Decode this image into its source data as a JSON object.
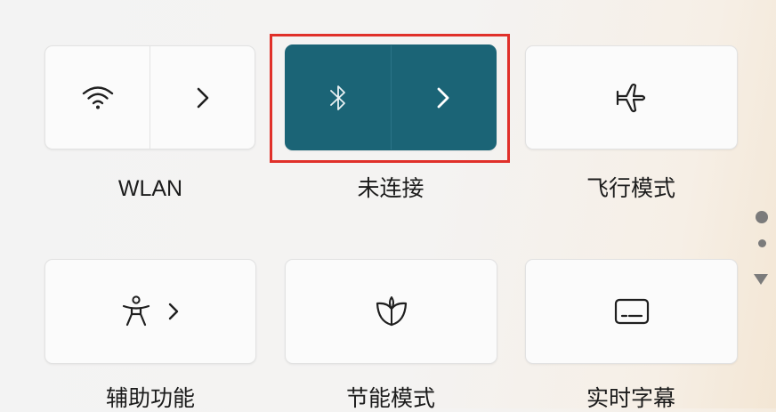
{
  "tiles": {
    "wlan": {
      "label": "WLAN",
      "icon": "wifi-icon",
      "chevron": "chevron-right-icon"
    },
    "bluetooth": {
      "label": "未连接",
      "icon": "bluetooth-icon",
      "chevron": "chevron-right-icon",
      "active": true
    },
    "airplane": {
      "label": "飞行模式",
      "icon": "airplane-icon"
    },
    "accessibility": {
      "label": "辅助功能",
      "icon": "accessibility-icon",
      "chevron": "chevron-right-icon"
    },
    "energy_saver": {
      "label": "节能模式",
      "icon": "leaf-icon"
    },
    "live_captions": {
      "label": "实时字幕",
      "icon": "captions-icon"
    }
  },
  "colors": {
    "active_tile": "#1b6476",
    "highlight": "#e0302a"
  }
}
